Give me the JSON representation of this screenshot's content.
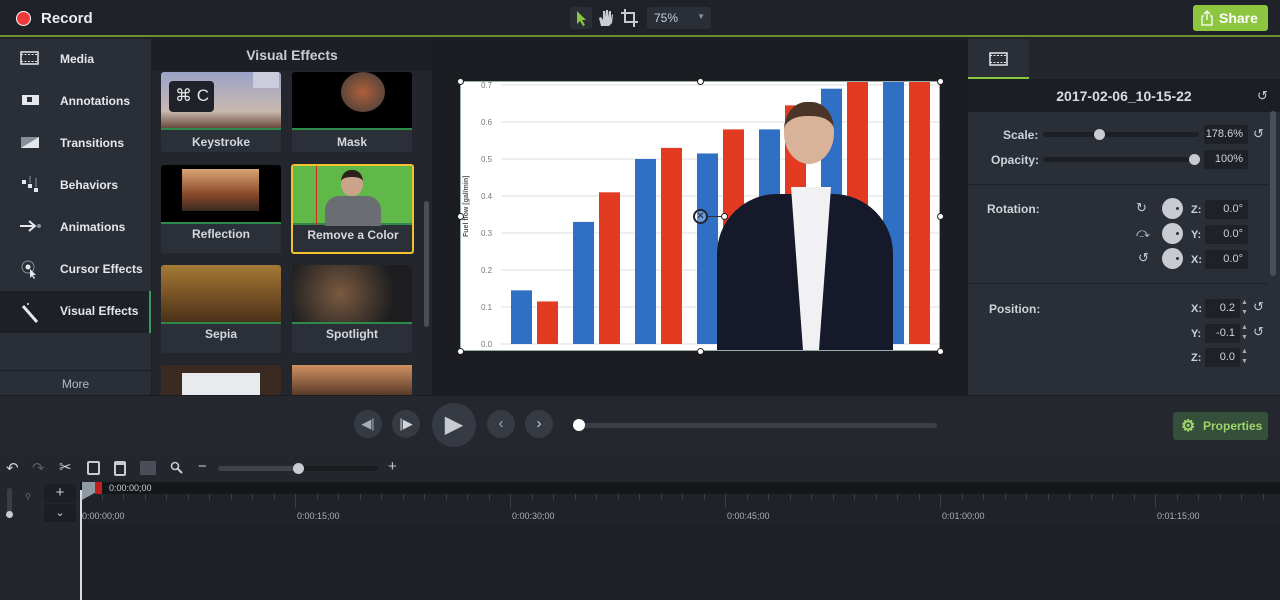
{
  "topbar": {
    "record_label": "Record",
    "zoom_value": "75%",
    "share_label": "Share",
    "accent": "#8cc63f",
    "record_color": "#f03a3a"
  },
  "nav": {
    "items": [
      {
        "label": "Media",
        "icon": "film-icon"
      },
      {
        "label": "Annotations",
        "icon": "annotation-icon"
      },
      {
        "label": "Transitions",
        "icon": "transition-icon"
      },
      {
        "label": "Behaviors",
        "icon": "behaviors-icon"
      },
      {
        "label": "Animations",
        "icon": "animation-arrow-icon"
      },
      {
        "label": "Cursor Effects",
        "icon": "cursor-effects-icon"
      },
      {
        "label": "Visual Effects",
        "icon": "magic-wand-icon",
        "active": true
      }
    ],
    "more_label": "More"
  },
  "effects": {
    "title": "Visual Effects",
    "keystroke_badge": "⌘ C",
    "tiles": [
      {
        "label": "Keystroke"
      },
      {
        "label": "Mask"
      },
      {
        "label": "Reflection"
      },
      {
        "label": "Remove a Color",
        "selected": true
      },
      {
        "label": "Sepia"
      },
      {
        "label": "Spotlight"
      }
    ]
  },
  "preview": {
    "y_axis_label": "Fuel flow [gal/min]",
    "y_ticks": [
      "0.0",
      "0.1",
      "0.2",
      "0.3",
      "0.4",
      "0.5",
      "0.6",
      "0.7"
    ],
    "bars": [
      [
        0.145,
        0.115
      ],
      [
        0.33,
        0.41
      ],
      [
        0.5,
        0.53
      ],
      [
        0.515,
        0.58
      ],
      [
        0.58,
        0.645
      ],
      [
        0.69,
        0.75
      ],
      [
        0.75,
        0.75
      ]
    ],
    "series_colors": [
      "#2f6fc4",
      "#e33b22"
    ]
  },
  "properties": {
    "clip_title": "2017-02-06_10-15-22",
    "scale_label": "Scale:",
    "scale_value": "178.6%",
    "scale_fraction": 0.36,
    "opacity_label": "Opacity:",
    "opacity_value": "100%",
    "opacity_fraction": 1.0,
    "rotation_label": "Rotation:",
    "rotation": [
      {
        "axis": "Z:",
        "value": "0.0°"
      },
      {
        "axis": "Y:",
        "value": "0.0°"
      },
      {
        "axis": "X:",
        "value": "0.0°"
      }
    ],
    "position_label": "Position:",
    "position": [
      {
        "axis": "X:",
        "value": "0.2"
      },
      {
        "axis": "Y:",
        "value": "-0.1"
      },
      {
        "axis": "Z:",
        "value": "0.0"
      }
    ],
    "properties_button": "Properties"
  },
  "playback": {
    "progress_fraction": 0.0
  },
  "timeline": {
    "playhead_time": "0:00:00;00",
    "ticks": [
      "0:00:00;00",
      "0:00:15;00",
      "0:00:30;00",
      "0:00:45;00",
      "0:01:00;00",
      "0:01:15;00"
    ],
    "zoom_fraction": 0.5
  }
}
